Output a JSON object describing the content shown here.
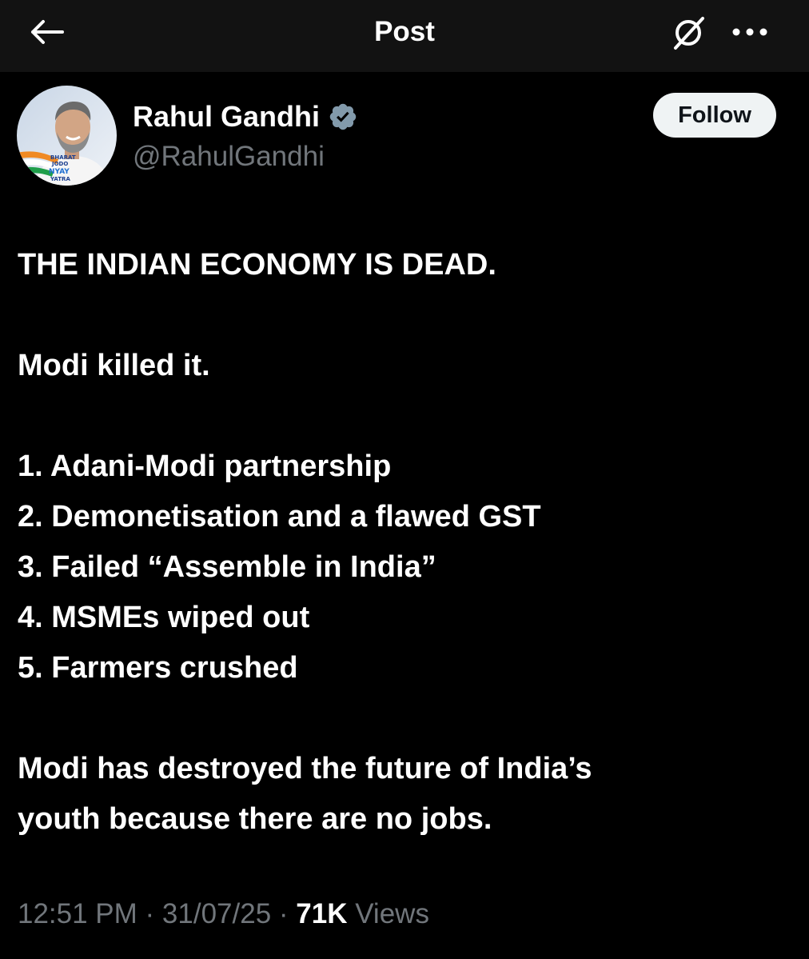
{
  "header": {
    "title": "Post",
    "back_icon": "arrow-left-icon",
    "grok_icon": "grok-icon",
    "more_icon": "more-horizontal-icon"
  },
  "author": {
    "display_name": "Rahul Gandhi",
    "handle": "@RahulGandhi",
    "verified_icon": "verified-badge-icon",
    "avatar_logo_text": [
      "BHARAT",
      "JODO",
      "NYAY",
      "YATRA"
    ]
  },
  "follow_button": {
    "label": "Follow"
  },
  "tweet": {
    "headline": "THE INDIAN ECONOMY IS DEAD.",
    "line2": "Modi killed it.",
    "list": [
      "1. Adani-Modi partnership",
      "2. Demonetisation and a flawed GST",
      "3. Failed “Assemble in India”",
      "4. MSMEs wiped out",
      "5. Farmers crushed"
    ],
    "closing_line1": "Modi has destroyed the future of India’s",
    "closing_line2": "youth because there are no jobs."
  },
  "meta": {
    "time": "12:51 PM",
    "separator": " · ",
    "date": "31/07/25",
    "views_count": "71K",
    "views_label": " Views"
  },
  "colors": {
    "background": "#000000",
    "header_background": "#121212",
    "text_primary": "#ffffff",
    "text_secondary": "#71767b",
    "follow_button_bg": "#eff3f4"
  }
}
